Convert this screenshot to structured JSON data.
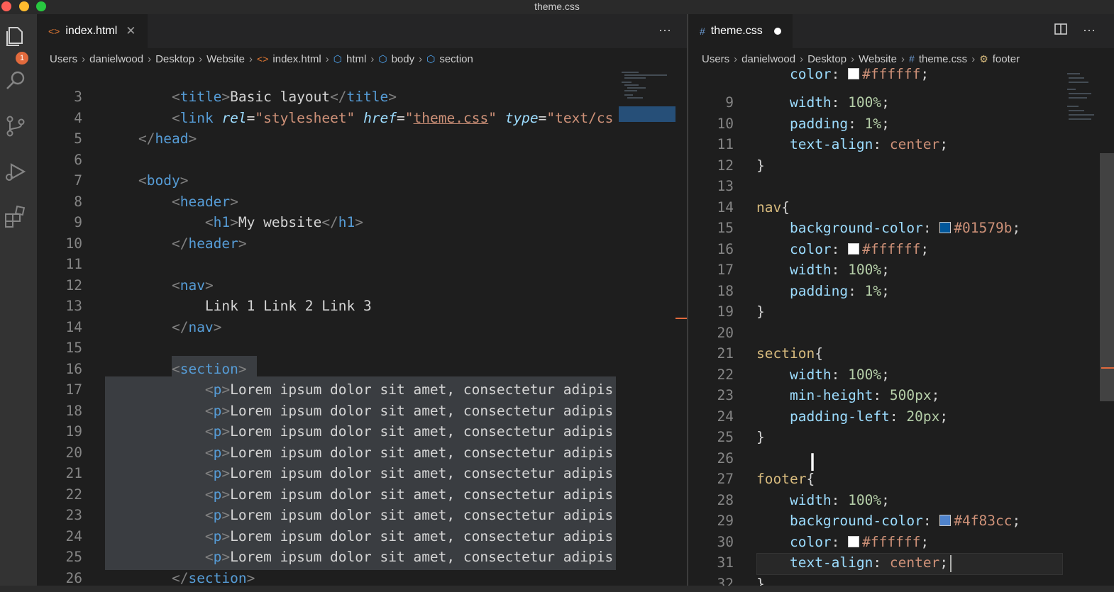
{
  "window": {
    "title": "theme.css"
  },
  "activity": {
    "badge": "1"
  },
  "left": {
    "tab": {
      "label": "index.html"
    },
    "breadcrumb": [
      "Users",
      "danielwood",
      "Desktop",
      "Website",
      "index.html",
      "html",
      "body",
      "section"
    ],
    "lines": [
      {
        "n": "3",
        "html": "    <span class=\"p\">&lt;</span><span class=\"t\">title</span><span class=\"p\">&gt;</span><span class=\"w\">Basic layout</span><span class=\"p\">&lt;/</span><span class=\"t\">title</span><span class=\"p\">&gt;</span>"
      },
      {
        "n": "4",
        "html": "    <span class=\"p\">&lt;</span><span class=\"t\">link</span> <span class=\"a\">rel</span><span class=\"w\">=</span><span class=\"s\">\"stylesheet\"</span> <span class=\"a\">href</span><span class=\"w\">=</span><span class=\"s\">\"</span><span class=\"u\">theme.css</span><span class=\"s\">\"</span> <span class=\"a\">type</span><span class=\"w\">=</span><span class=\"s\">\"text/cs</span>"
      },
      {
        "n": "5",
        "html": "<span class=\"p\">&lt;/</span><span class=\"t\">head</span><span class=\"p\">&gt;</span>"
      },
      {
        "n": "6",
        "html": ""
      },
      {
        "n": "7",
        "html": "<span class=\"p\">&lt;</span><span class=\"t\">body</span><span class=\"p\">&gt;</span>"
      },
      {
        "n": "8",
        "html": "    <span class=\"p\">&lt;</span><span class=\"t\">header</span><span class=\"p\">&gt;</span>"
      },
      {
        "n": "9",
        "html": "        <span class=\"p\">&lt;</span><span class=\"t\">h1</span><span class=\"p\">&gt;</span><span class=\"w\">My website</span><span class=\"p\">&lt;/</span><span class=\"t\">h1</span><span class=\"p\">&gt;</span>"
      },
      {
        "n": "10",
        "html": "    <span class=\"p\">&lt;/</span><span class=\"t\">header</span><span class=\"p\">&gt;</span>"
      },
      {
        "n": "11",
        "html": ""
      },
      {
        "n": "12",
        "html": "    <span class=\"p\">&lt;</span><span class=\"t\">nav</span><span class=\"p\">&gt;</span>"
      },
      {
        "n": "13",
        "html": "        <span class=\"w\">Link 1 Link 2 Link 3</span>"
      },
      {
        "n": "14",
        "html": "    <span class=\"p\">&lt;/</span><span class=\"t\">nav</span><span class=\"p\">&gt;</span>"
      },
      {
        "n": "15",
        "html": ""
      },
      {
        "n": "16",
        "html": "    <span class=\"p\">&lt;</span><span class=\"t\">section</span><span class=\"p\">&gt;</span>"
      },
      {
        "n": "17",
        "html": "        <span class=\"p\">&lt;</span><span class=\"t\">p</span><span class=\"p\">&gt;</span><span class=\"w\">Lorem ipsum dolor sit amet, consectetur adipis</span>"
      },
      {
        "n": "18",
        "html": "        <span class=\"p\">&lt;</span><span class=\"t\">p</span><span class=\"p\">&gt;</span><span class=\"w\">Lorem ipsum dolor sit amet, consectetur adipis</span>"
      },
      {
        "n": "19",
        "html": "        <span class=\"p\">&lt;</span><span class=\"t\">p</span><span class=\"p\">&gt;</span><span class=\"w\">Lorem ipsum dolor sit amet, consectetur adipis</span>"
      },
      {
        "n": "20",
        "html": "        <span class=\"p\">&lt;</span><span class=\"t\">p</span><span class=\"p\">&gt;</span><span class=\"w\">Lorem ipsum dolor sit amet, consectetur adipis</span>"
      },
      {
        "n": "21",
        "html": "        <span class=\"p\">&lt;</span><span class=\"t\">p</span><span class=\"p\">&gt;</span><span class=\"w\">Lorem ipsum dolor sit amet, consectetur adipis</span>"
      },
      {
        "n": "22",
        "html": "        <span class=\"p\">&lt;</span><span class=\"t\">p</span><span class=\"p\">&gt;</span><span class=\"w\">Lorem ipsum dolor sit amet, consectetur adipis</span>"
      },
      {
        "n": "23",
        "html": "        <span class=\"p\">&lt;</span><span class=\"t\">p</span><span class=\"p\">&gt;</span><span class=\"w\">Lorem ipsum dolor sit amet, consectetur adipis</span>"
      },
      {
        "n": "24",
        "html": "        <span class=\"p\">&lt;</span><span class=\"t\">p</span><span class=\"p\">&gt;</span><span class=\"w\">Lorem ipsum dolor sit amet, consectetur adipis</span>"
      },
      {
        "n": "25",
        "html": "        <span class=\"p\">&lt;</span><span class=\"t\">p</span><span class=\"p\">&gt;</span><span class=\"w\">Lorem ipsum dolor sit amet, consectetur adipis</span>"
      },
      {
        "n": "26",
        "html": "    <span class=\"p\">&lt;/</span><span class=\"t\">section</span><span class=\"p\">&gt;</span>"
      }
    ]
  },
  "right": {
    "tab": {
      "label": "theme.css"
    },
    "breadcrumb": [
      "Users",
      "danielwood",
      "Desktop",
      "Website",
      "theme.css",
      "footer"
    ],
    "lines": [
      {
        "n": "9",
        "html": "    <span class=\"prop\">width</span><span class=\"w\">: </span><span class=\"num\">100%</span><span class=\"w\">;</span>"
      },
      {
        "n": "10",
        "html": "    <span class=\"prop\">padding</span><span class=\"w\">: </span><span class=\"num\">1%</span><span class=\"w\">;</span>"
      },
      {
        "n": "11",
        "html": "    <span class=\"prop\">text-align</span><span class=\"w\">: </span><span class=\"val\">center</span><span class=\"w\">;</span>"
      },
      {
        "n": "12",
        "html": "<span class=\"brace\">}</span>"
      },
      {
        "n": "13",
        "html": ""
      },
      {
        "n": "14",
        "html": "<span class=\"sel-tag\">nav</span><span class=\"brace\">{</span>"
      },
      {
        "n": "15",
        "html": "    <span class=\"prop\">background-color</span><span class=\"w\">: </span><span class=\"swatch\" style=\"background:#01579b\"></span><span class=\"val\">#01579b</span><span class=\"w\">;</span>"
      },
      {
        "n": "16",
        "html": "    <span class=\"prop\">color</span><span class=\"w\">: </span><span class=\"swatch\" style=\"background:#ffffff\"></span><span class=\"val\">#ffffff</span><span class=\"w\">;</span>"
      },
      {
        "n": "17",
        "html": "    <span class=\"prop\">width</span><span class=\"w\">: </span><span class=\"num\">100%</span><span class=\"w\">;</span>"
      },
      {
        "n": "18",
        "html": "    <span class=\"prop\">padding</span><span class=\"w\">: </span><span class=\"num\">1%</span><span class=\"w\">;</span>"
      },
      {
        "n": "19",
        "html": "<span class=\"brace\">}</span>"
      },
      {
        "n": "20",
        "html": ""
      },
      {
        "n": "21",
        "html": "<span class=\"sel-tag\">section</span><span class=\"brace\">{</span>"
      },
      {
        "n": "22",
        "html": "    <span class=\"prop\">width</span><span class=\"w\">: </span><span class=\"num\">100%</span><span class=\"w\">;</span>"
      },
      {
        "n": "23",
        "html": "    <span class=\"prop\">min-height</span><span class=\"w\">: </span><span class=\"num\">500px</span><span class=\"w\">;</span>"
      },
      {
        "n": "24",
        "html": "    <span class=\"prop\">padding-left</span><span class=\"w\">: </span><span class=\"num\">20px</span><span class=\"w\">;</span>"
      },
      {
        "n": "25",
        "html": "<span class=\"brace\">}</span>"
      },
      {
        "n": "26",
        "html": ""
      },
      {
        "n": "27",
        "html": "<span class=\"sel-tag\">footer</span><span class=\"brace\">{</span>"
      },
      {
        "n": "28",
        "html": "    <span class=\"prop\">width</span><span class=\"w\">: </span><span class=\"num\">100%</span><span class=\"w\">;</span>"
      },
      {
        "n": "29",
        "html": "    <span class=\"prop\">background-color</span><span class=\"w\">: </span><span class=\"swatch\" style=\"background:#4f83cc\"></span><span class=\"val\">#4f83cc</span><span class=\"w\">;</span>"
      },
      {
        "n": "30",
        "html": "    <span class=\"prop\">color</span><span class=\"w\">: </span><span class=\"swatch\" style=\"background:#ffffff\"></span><span class=\"val\">#ffffff</span><span class=\"w\">;</span>"
      },
      {
        "n": "31",
        "html": "    <span class=\"prop\">text-align</span><span class=\"w\">: </span><span class=\"val\">center</span><span class=\"w\">;</span>"
      },
      {
        "n": "32",
        "html": "<span class=\"brace\">}</span>"
      }
    ]
  }
}
